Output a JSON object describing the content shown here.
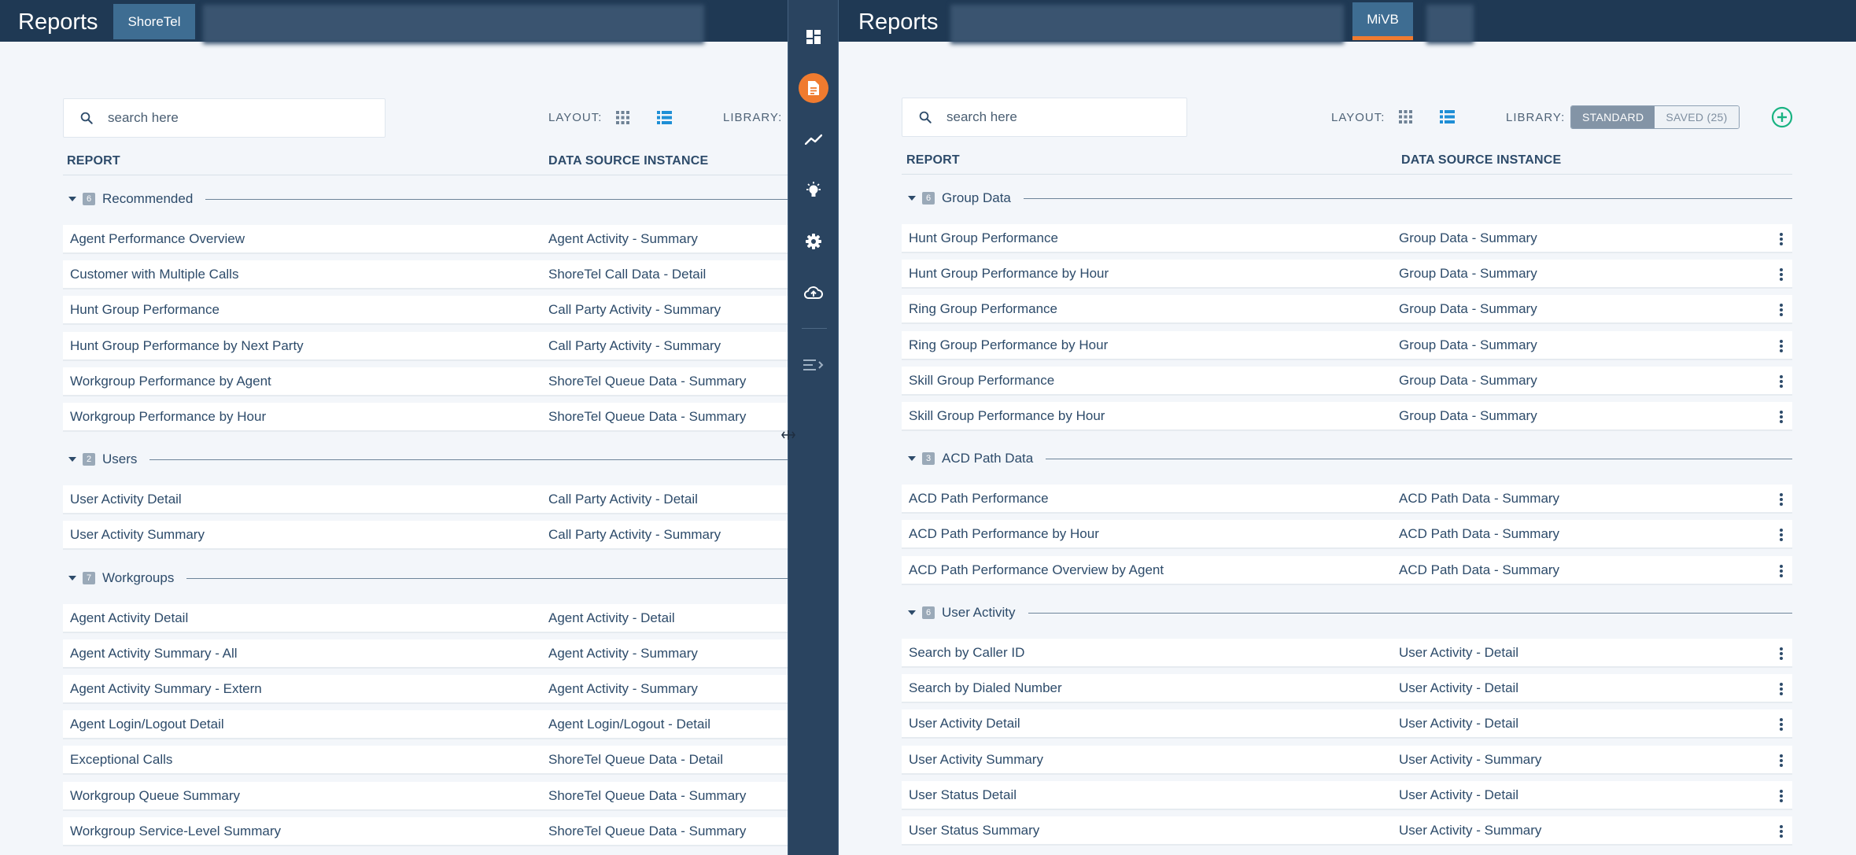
{
  "colors": {
    "topbar": "#1f3954",
    "active_tab": "#3e6d92",
    "accent_orange": "#f07b2f",
    "sidenav": "#2a4460",
    "add_green": "#19b382",
    "text_primary": "#2d4b6a"
  },
  "left": {
    "app_title": "Reports",
    "active_tab": "ShoreTel",
    "search": {
      "placeholder": "search here"
    },
    "layout_label": "LAYOUT:",
    "library_label": "LIBRARY:",
    "columns": {
      "report": "REPORT",
      "data_source": "DATA SOURCE INSTANCE"
    },
    "groups": [
      {
        "name": "Recommended",
        "count": "6",
        "rows": [
          {
            "report": "Agent Performance Overview",
            "source": "Agent Activity - Summary"
          },
          {
            "report": "Customer with Multiple Calls",
            "source": "ShoreTel Call Data - Detail"
          },
          {
            "report": "Hunt Group Performance",
            "source": "Call Party Activity - Summary"
          },
          {
            "report": "Hunt Group Performance by Next Party",
            "source": "Call Party Activity - Summary"
          },
          {
            "report": "Workgroup Performance by Agent",
            "source": "ShoreTel Queue Data - Summary"
          },
          {
            "report": "Workgroup Performance by Hour",
            "source": "ShoreTel Queue Data - Summary"
          }
        ]
      },
      {
        "name": "Users",
        "count": "2",
        "rows": [
          {
            "report": "User Activity Detail",
            "source": "Call Party Activity - Detail"
          },
          {
            "report": "User Activity Summary",
            "source": "Call Party Activity - Summary"
          }
        ]
      },
      {
        "name": "Workgroups",
        "count": "7",
        "rows": [
          {
            "report": "Agent Activity Detail",
            "source": "Agent Activity - Detail"
          },
          {
            "report": "Agent Activity Summary - All",
            "source": "Agent Activity - Summary"
          },
          {
            "report": "Agent Activity Summary - Extern",
            "source": "Agent Activity - Summary"
          },
          {
            "report": "Agent Login/Logout Detail",
            "source": "Agent Login/Logout - Detail"
          },
          {
            "report": "Exceptional Calls",
            "source": "ShoreTel Queue Data - Detail"
          },
          {
            "report": "Workgroup Queue Summary",
            "source": "ShoreTel Queue Data - Summary"
          },
          {
            "report": "Workgroup Service-Level Summary",
            "source": "ShoreTel Queue Data - Summary"
          }
        ]
      }
    ]
  },
  "right": {
    "app_title": "Reports",
    "active_tab": "MiVB",
    "search": {
      "placeholder": "search here"
    },
    "layout_label": "LAYOUT:",
    "library_label": "LIBRARY:",
    "library_standard": "STANDARD",
    "library_saved": "SAVED (25)",
    "columns": {
      "report": "REPORT",
      "data_source": "DATA SOURCE INSTANCE"
    },
    "groups": [
      {
        "name": "Group Data",
        "count": "6",
        "rows": [
          {
            "report": "Hunt Group Performance",
            "source": "Group Data - Summary"
          },
          {
            "report": "Hunt Group Performance by Hour",
            "source": "Group Data - Summary"
          },
          {
            "report": "Ring Group Performance",
            "source": "Group Data - Summary"
          },
          {
            "report": "Ring Group Performance by Hour",
            "source": "Group Data - Summary"
          },
          {
            "report": "Skill Group Performance",
            "source": "Group Data - Summary"
          },
          {
            "report": "Skill Group Performance by Hour",
            "source": "Group Data - Summary"
          }
        ]
      },
      {
        "name": "ACD Path Data",
        "count": "3",
        "rows": [
          {
            "report": "ACD Path Performance",
            "source": "ACD Path Data - Summary"
          },
          {
            "report": "ACD Path Performance by Hour",
            "source": "ACD Path Data - Summary"
          },
          {
            "report": "ACD Path Performance Overview by Agent",
            "source": "ACD Path Data - Summary"
          }
        ]
      },
      {
        "name": "User Activity",
        "count": "6",
        "rows": [
          {
            "report": "Search by Caller ID",
            "source": "User Activity - Detail"
          },
          {
            "report": "Search by Dialed Number",
            "source": "User Activity - Detail"
          },
          {
            "report": "User Activity Detail",
            "source": "User Activity - Detail"
          },
          {
            "report": "User Activity Summary",
            "source": "User Activity - Summary"
          },
          {
            "report": "User Status Detail",
            "source": "User Activity - Detail"
          },
          {
            "report": "User Status Summary",
            "source": "User Activity - Summary"
          }
        ]
      }
    ]
  },
  "sidenav": {
    "items": [
      "dashboard-icon",
      "reports-icon",
      "trends-icon",
      "insights-icon",
      "settings-icon",
      "cloud-upload-icon",
      "collapse-menu-icon"
    ]
  }
}
